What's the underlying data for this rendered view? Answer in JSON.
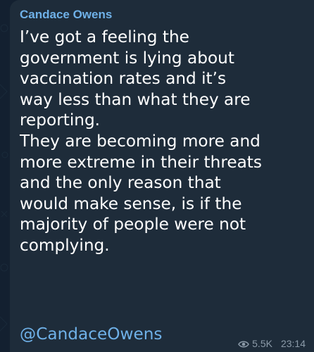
{
  "message": {
    "sender": "Candace Owens",
    "text": "I’ve got a feeling the\ngovernment is lying about\nvaccination rates and it’s\nway less than what they are\nreporting.\nThey are becoming more and\nmore extreme in their threats\nand the only reason that\nwould make sense, is if the\nmajority of people were not\ncomplying.",
    "mention": "@CandaceOwens",
    "views": "5.5K",
    "time": "23:14"
  },
  "colors": {
    "bubble": "#1e2c3a",
    "sender": "#6fb1e8",
    "link": "#6fb1e8",
    "meta": "#8b9aa8"
  }
}
